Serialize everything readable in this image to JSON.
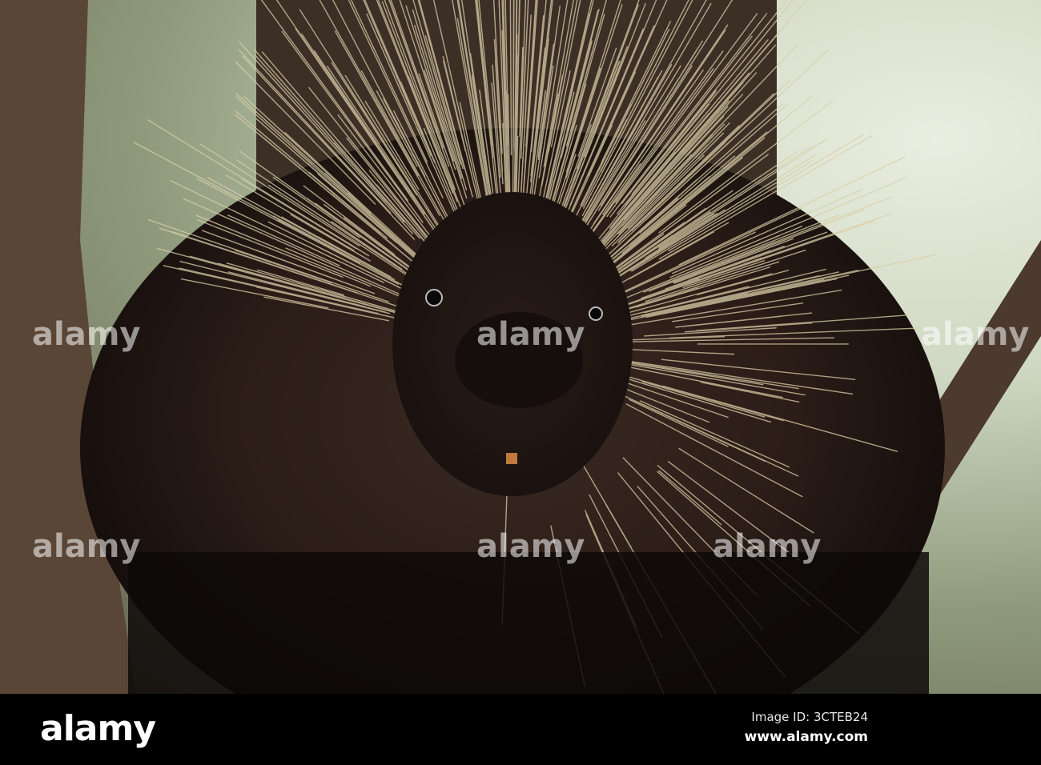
{
  "watermark": {
    "brand": "alamy"
  },
  "footer": {
    "logo": "alamy",
    "image_id": "Image ID: 3CTEB24",
    "website": "www.alamy.com"
  },
  "colors": {
    "footer_bg": "#000000",
    "fur": "#2a1c17",
    "quills": "#d9cfa8"
  }
}
